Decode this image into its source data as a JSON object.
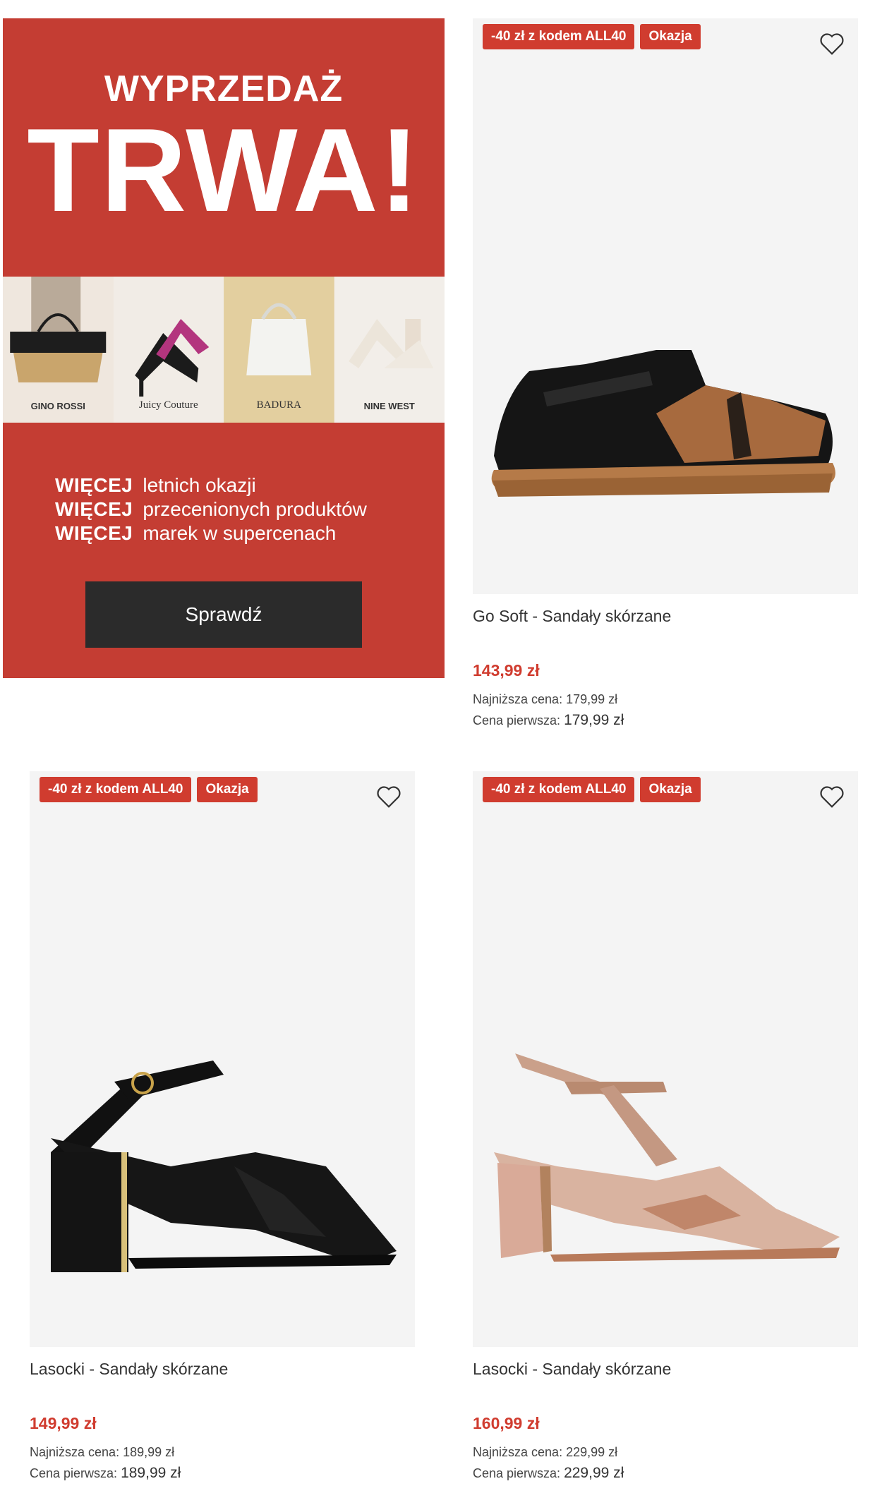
{
  "banner": {
    "headline_small": "WYPRZEDAŻ",
    "headline_big": "TRWA!",
    "brands": [
      "GINO ROSSI",
      "Juicy Couture",
      "BADURA",
      "NINE WEST"
    ],
    "perks": [
      {
        "keyword": "WIĘCEJ",
        "text": "letnich okazji"
      },
      {
        "keyword": "WIĘCEJ",
        "text": "przecenionych produktów"
      },
      {
        "keyword": "WIĘCEJ",
        "text": "marek w supercenach"
      }
    ],
    "cta_label": "Sprawdź",
    "color": "#c43d33"
  },
  "products": [
    {
      "badges": [
        "-40 zł z kodem ALL40",
        "Okazja"
      ],
      "name": "Go Soft - Sandały skórzane",
      "price": "143,99 zł",
      "lowest_label": "Najniższa cena:",
      "lowest_value": "179,99 zł",
      "first_label": "Cena pierwsza:",
      "first_value": "179,99 zł",
      "icon": "heart-icon"
    },
    {
      "badges": [
        "-40 zł z kodem ALL40",
        "Okazja"
      ],
      "name": "Lasocki - Sandały skórzane",
      "price": "149,99 zł",
      "lowest_label": "Najniższa cena:",
      "lowest_value": "189,99 zł",
      "first_label": "Cena pierwsza:",
      "first_value": "189,99 zł",
      "icon": "heart-icon"
    },
    {
      "badges": [
        "-40 zł z kodem ALL40",
        "Okazja"
      ],
      "name": "Lasocki - Sandały skórzane",
      "price": "160,99 zł",
      "lowest_label": "Najniższa cena:",
      "lowest_value": "229,99 zł",
      "first_label": "Cena pierwsza:",
      "first_value": "229,99 zł",
      "icon": "heart-icon"
    }
  ],
  "colors": {
    "accent": "#d03c2f",
    "card_bg": "#f4f4f4",
    "cta_bg": "#2b2b2b"
  }
}
